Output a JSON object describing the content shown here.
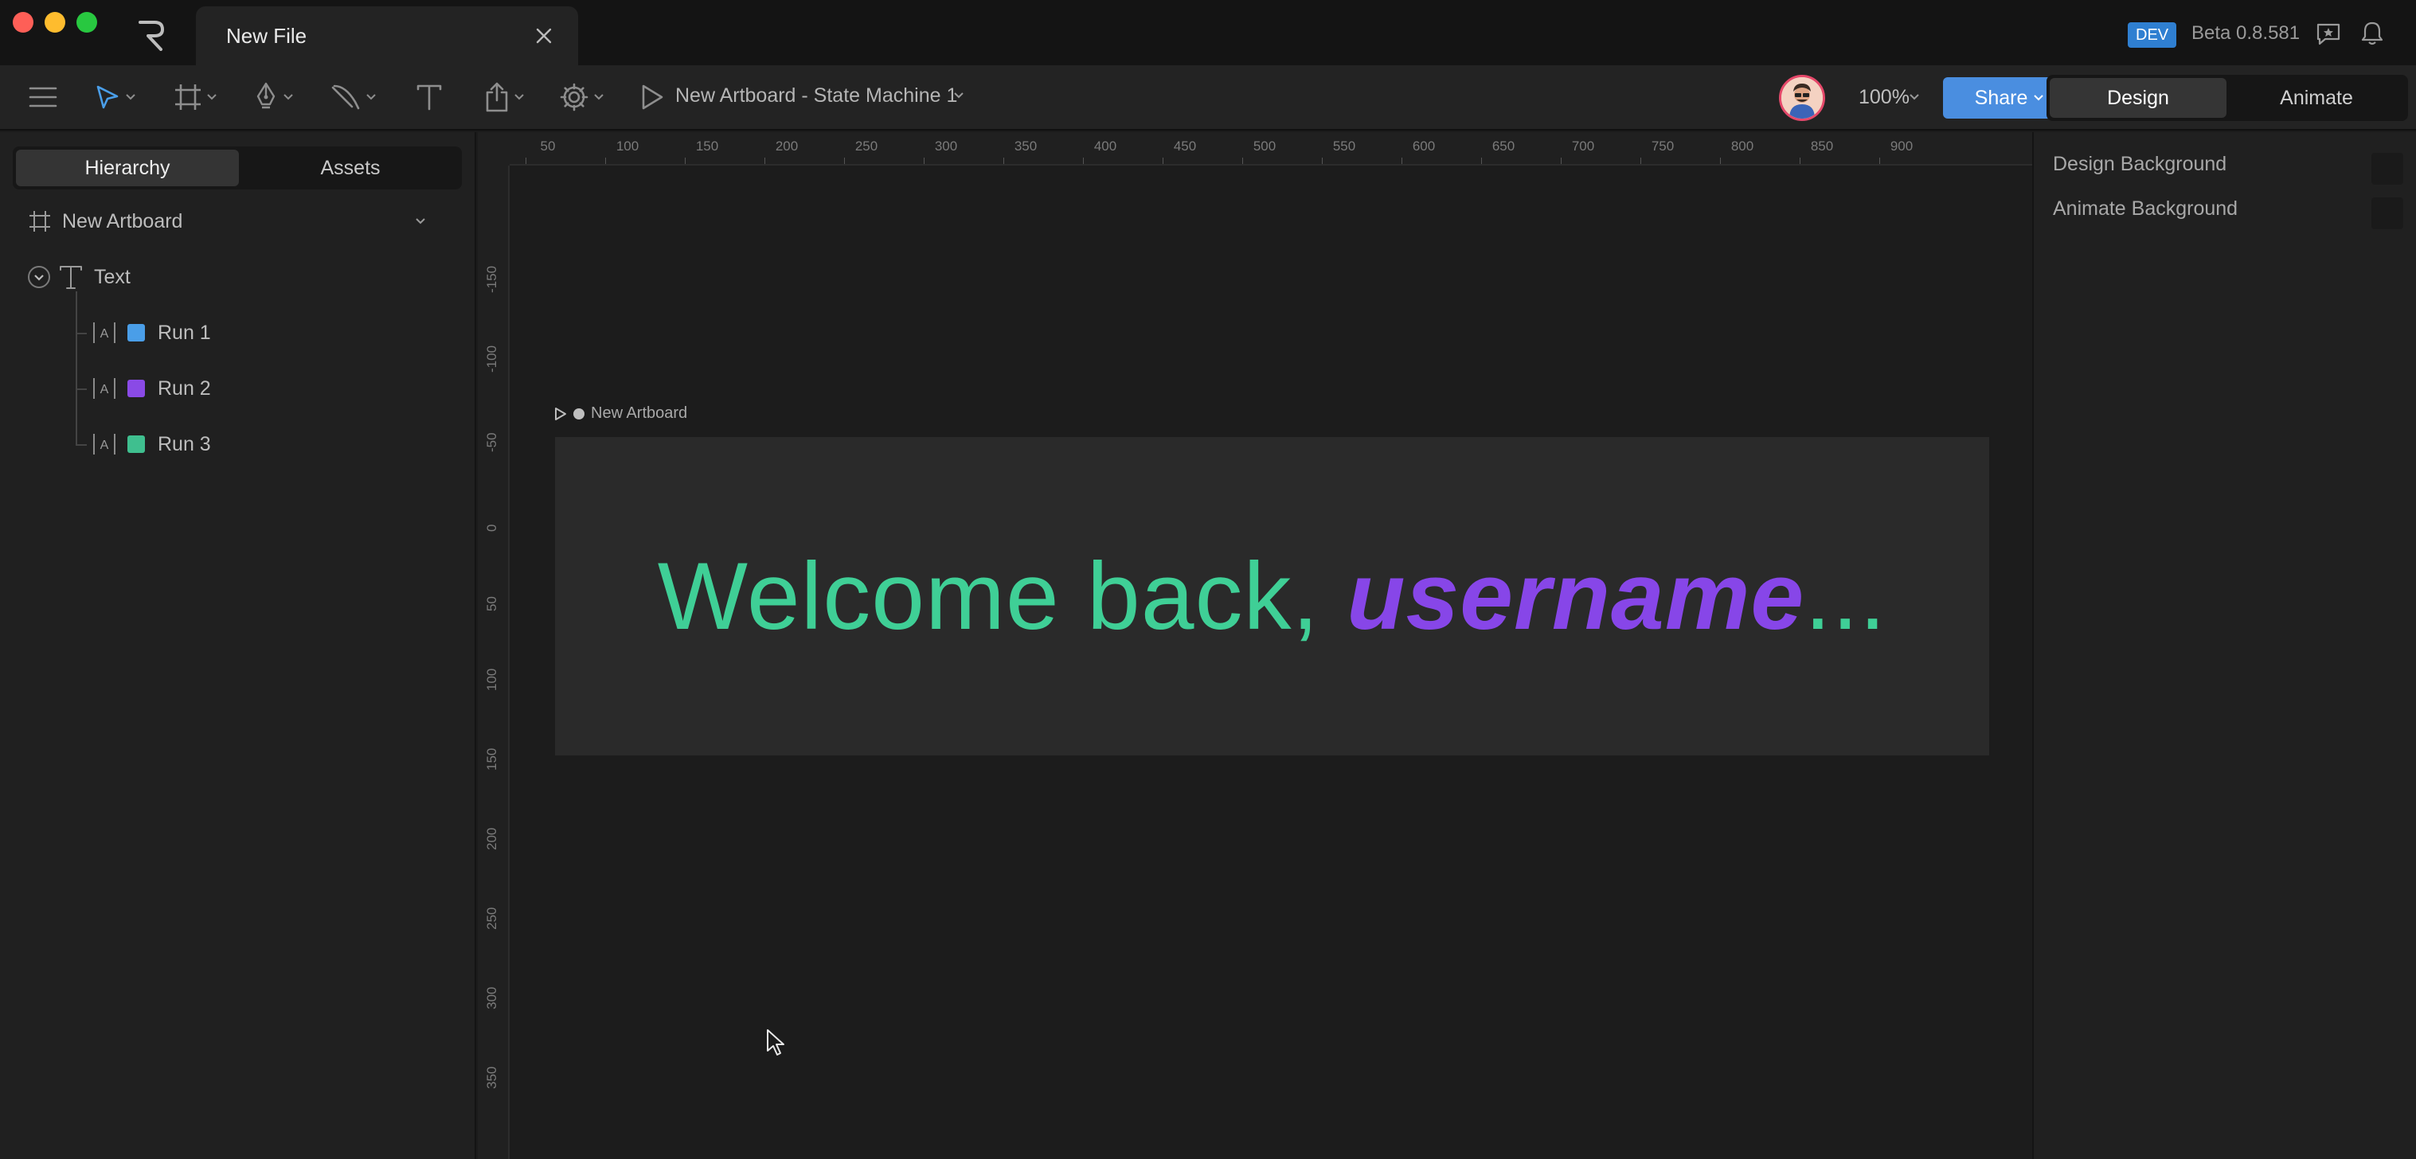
{
  "window": {
    "tab_title": "New File",
    "build_badge": "DEV",
    "version": "Beta 0.8.581"
  },
  "toolbar": {
    "state_machine_title": "New Artboard - State Machine 1",
    "zoom": "100%",
    "share_label": "Share",
    "modes": {
      "design": "Design",
      "animate": "Animate"
    }
  },
  "left_panel": {
    "tabs": {
      "hierarchy": "Hierarchy",
      "assets": "Assets"
    },
    "tree": {
      "artboard": "New Artboard",
      "text_node": "Text",
      "runs": [
        {
          "label": "Run 1",
          "color": "#4a9ee8"
        },
        {
          "label": "Run 2",
          "color": "#8a4ae6"
        },
        {
          "label": "Run 3",
          "color": "#3fbf8f"
        }
      ]
    }
  },
  "canvas": {
    "ruler_x": [
      "50",
      "100",
      "150",
      "200",
      "250",
      "300",
      "350",
      "400",
      "450",
      "500",
      "550",
      "600",
      "650",
      "700",
      "750",
      "800",
      "850",
      "900"
    ],
    "ruler_y": [
      "-150",
      "-100",
      "-50",
      "0",
      "50",
      "100",
      "150",
      "200",
      "250",
      "300",
      "350"
    ],
    "artboard_label": "New Artboard",
    "text_runs": {
      "run1": "Welcome back, ",
      "run2": "username",
      "run3": "..."
    },
    "colors": {
      "run1": "#3fcf96",
      "run2": "#8746e8",
      "run3": "#3fcf96"
    }
  },
  "right_panel": {
    "design_background": "Design Background",
    "animate_background": "Animate Background"
  }
}
